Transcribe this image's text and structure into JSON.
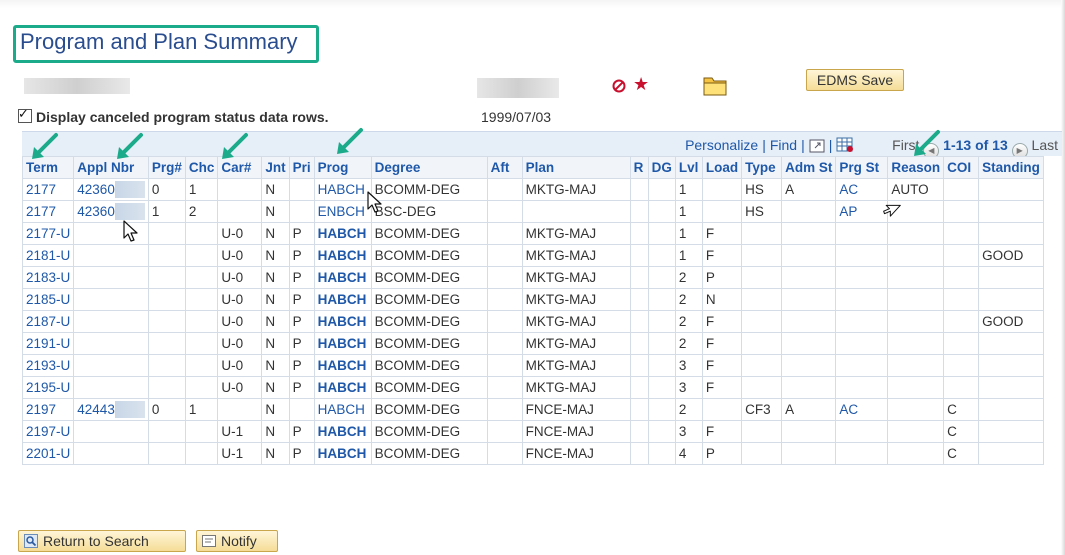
{
  "page": {
    "title": "Program and Plan Summary",
    "edms_save_label": "EDMS Save",
    "display_canceled_label": "Display canceled program status data rows.",
    "display_canceled_checked": true,
    "date": "1999/07/03"
  },
  "grid_nav": {
    "personalize": "Personalize",
    "separator": "|",
    "find": "Find",
    "first": "First",
    "range": "1-13 of 13",
    "last": "Last"
  },
  "icons": {
    "cancel": "cancel-circle-icon",
    "star": "favorite-star-icon",
    "folder": "folder-icon",
    "view_all": "view-all-icon",
    "download": "download-spreadsheet-icon",
    "prev": "prev-arrow-icon",
    "next": "next-arrow-icon",
    "search": "search-icon",
    "notify": "notify-icon"
  },
  "colors": {
    "accent_teal": "#1bab8a",
    "link_blue": "#1f58a8",
    "title_blue": "#2a4d8f",
    "button_gold": "#f5dc97"
  },
  "columns": [
    "Term",
    "Appl Nbr",
    "Prg#",
    "Chc",
    "Car#",
    "Jnt",
    "Pri",
    "Prog",
    "Degree",
    "Aft",
    "Plan",
    "R",
    "DG",
    "Lvl",
    "Load",
    "Type",
    "Adm St",
    "Prg St",
    "Reason",
    "COI",
    "Standing"
  ],
  "rows": [
    {
      "term": "2177",
      "appl": "42360",
      "prg": "0",
      "chc": "1",
      "car": "",
      "jnt": "N",
      "pri": "",
      "prog": "HABCH",
      "degree": "BCOMM-DEG",
      "aft": "",
      "plan": "MKTG-MAJ",
      "r": "",
      "dg": "",
      "lvl": "1",
      "load": "",
      "type": "HS",
      "adm": "A",
      "prgst": "AC",
      "reason": "AUTO",
      "coi": "",
      "standing": ""
    },
    {
      "term": "2177",
      "appl": "42360",
      "prg": "1",
      "chc": "2",
      "car": "",
      "jnt": "N",
      "pri": "",
      "prog": "ENBCH",
      "degree": "BSC-DEG",
      "aft": "",
      "plan": "",
      "r": "",
      "dg": "",
      "lvl": "1",
      "load": "",
      "type": "HS",
      "adm": "",
      "prgst": "AP",
      "reason": "",
      "coi": "",
      "standing": ""
    },
    {
      "term": "2177-U",
      "appl": "",
      "prg": "",
      "chc": "",
      "car": "U-0",
      "jnt": "N",
      "pri": "P",
      "prog": "HABCH",
      "degree": "BCOMM-DEG",
      "aft": "",
      "plan": "MKTG-MAJ",
      "r": "",
      "dg": "",
      "lvl": "1",
      "load": "F",
      "type": "",
      "adm": "",
      "prgst": "",
      "reason": "",
      "coi": "",
      "standing": ""
    },
    {
      "term": "2181-U",
      "appl": "",
      "prg": "",
      "chc": "",
      "car": "U-0",
      "jnt": "N",
      "pri": "P",
      "prog": "HABCH",
      "degree": "BCOMM-DEG",
      "aft": "",
      "plan": "MKTG-MAJ",
      "r": "",
      "dg": "",
      "lvl": "1",
      "load": "F",
      "type": "",
      "adm": "",
      "prgst": "",
      "reason": "",
      "coi": "",
      "standing": "GOOD"
    },
    {
      "term": "2183-U",
      "appl": "",
      "prg": "",
      "chc": "",
      "car": "U-0",
      "jnt": "N",
      "pri": "P",
      "prog": "HABCH",
      "degree": "BCOMM-DEG",
      "aft": "",
      "plan": "MKTG-MAJ",
      "r": "",
      "dg": "",
      "lvl": "2",
      "load": "P",
      "type": "",
      "adm": "",
      "prgst": "",
      "reason": "",
      "coi": "",
      "standing": ""
    },
    {
      "term": "2185-U",
      "appl": "",
      "prg": "",
      "chc": "",
      "car": "U-0",
      "jnt": "N",
      "pri": "P",
      "prog": "HABCH",
      "degree": "BCOMM-DEG",
      "aft": "",
      "plan": "MKTG-MAJ",
      "r": "",
      "dg": "",
      "lvl": "2",
      "load": "N",
      "type": "",
      "adm": "",
      "prgst": "",
      "reason": "",
      "coi": "",
      "standing": ""
    },
    {
      "term": "2187-U",
      "appl": "",
      "prg": "",
      "chc": "",
      "car": "U-0",
      "jnt": "N",
      "pri": "P",
      "prog": "HABCH",
      "degree": "BCOMM-DEG",
      "aft": "",
      "plan": "MKTG-MAJ",
      "r": "",
      "dg": "",
      "lvl": "2",
      "load": "F",
      "type": "",
      "adm": "",
      "prgst": "",
      "reason": "",
      "coi": "",
      "standing": "GOOD"
    },
    {
      "term": "2191-U",
      "appl": "",
      "prg": "",
      "chc": "",
      "car": "U-0",
      "jnt": "N",
      "pri": "P",
      "prog": "HABCH",
      "degree": "BCOMM-DEG",
      "aft": "",
      "plan": "MKTG-MAJ",
      "r": "",
      "dg": "",
      "lvl": "2",
      "load": "F",
      "type": "",
      "adm": "",
      "prgst": "",
      "reason": "",
      "coi": "",
      "standing": ""
    },
    {
      "term": "2193-U",
      "appl": "",
      "prg": "",
      "chc": "",
      "car": "U-0",
      "jnt": "N",
      "pri": "P",
      "prog": "HABCH",
      "degree": "BCOMM-DEG",
      "aft": "",
      "plan": "MKTG-MAJ",
      "r": "",
      "dg": "",
      "lvl": "3",
      "load": "F",
      "type": "",
      "adm": "",
      "prgst": "",
      "reason": "",
      "coi": "",
      "standing": ""
    },
    {
      "term": "2195-U",
      "appl": "",
      "prg": "",
      "chc": "",
      "car": "U-0",
      "jnt": "N",
      "pri": "P",
      "prog": "HABCH",
      "degree": "BCOMM-DEG",
      "aft": "",
      "plan": "MKTG-MAJ",
      "r": "",
      "dg": "",
      "lvl": "3",
      "load": "F",
      "type": "",
      "adm": "",
      "prgst": "",
      "reason": "",
      "coi": "",
      "standing": ""
    },
    {
      "term": "2197",
      "appl": "42443",
      "prg": "0",
      "chc": "1",
      "car": "",
      "jnt": "N",
      "pri": "",
      "prog": "HABCH",
      "degree": "BCOMM-DEG",
      "aft": "",
      "plan": "FNCE-MAJ",
      "r": "",
      "dg": "",
      "lvl": "2",
      "load": "",
      "type": "CF3",
      "adm": "A",
      "prgst": "AC",
      "reason": "",
      "coi": "C",
      "standing": ""
    },
    {
      "term": "2197-U",
      "appl": "",
      "prg": "",
      "chc": "",
      "car": "U-1",
      "jnt": "N",
      "pri": "P",
      "prog": "HABCH",
      "degree": "BCOMM-DEG",
      "aft": "",
      "plan": "FNCE-MAJ",
      "r": "",
      "dg": "",
      "lvl": "3",
      "load": "F",
      "type": "",
      "adm": "",
      "prgst": "",
      "reason": "",
      "coi": "C",
      "standing": ""
    },
    {
      "term": "2201-U",
      "appl": "",
      "prg": "",
      "chc": "",
      "car": "U-1",
      "jnt": "N",
      "pri": "P",
      "prog": "HABCH",
      "degree": "BCOMM-DEG",
      "aft": "",
      "plan": "FNCE-MAJ",
      "r": "",
      "dg": "",
      "lvl": "4",
      "load": "P",
      "type": "",
      "adm": "",
      "prgst": "",
      "reason": "",
      "coi": "C",
      "standing": ""
    }
  ],
  "footer": {
    "return_label": "Return to Search",
    "notify_label": "Notify"
  }
}
